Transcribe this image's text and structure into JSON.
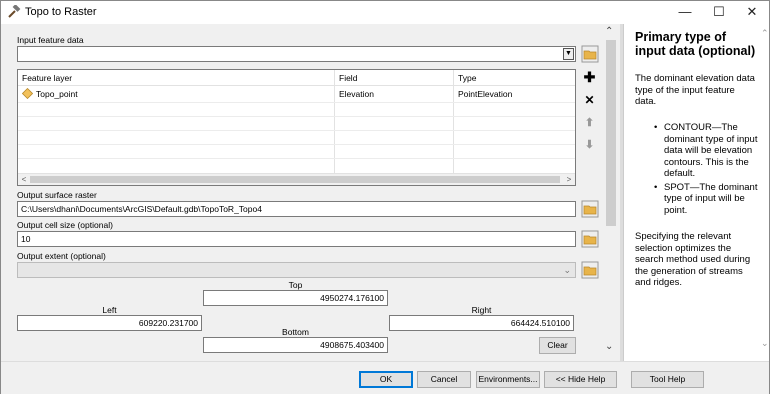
{
  "window": {
    "title": "Topo to Raster",
    "minimize": "—",
    "maximize": "☐",
    "close": "✕"
  },
  "params": {
    "input_feature_data_label": "Input feature data",
    "input_feature_data_value": "",
    "table": {
      "columns": [
        "Feature layer",
        "Field",
        "Type"
      ],
      "rows": [
        {
          "layer": "Topo_point",
          "field": "Elevation",
          "type": "PointElevation"
        }
      ]
    },
    "output_surface_raster_label": "Output surface raster",
    "output_surface_raster_value": "C:\\Users\\dhani\\Documents\\ArcGIS\\Default.gdb\\TopoToR_Topo4",
    "output_cell_size_label": "Output cell size (optional)",
    "output_cell_size_value": "10",
    "output_extent_label": "Output extent (optional)",
    "output_extent_value": "",
    "extent": {
      "top_label": "Top",
      "top_value": "4950274.176100",
      "left_label": "Left",
      "left_value": "609220.231700",
      "right_label": "Right",
      "right_value": "664424.510100",
      "bottom_label": "Bottom",
      "bottom_value": "4908675.403400",
      "clear_label": "Clear"
    }
  },
  "help": {
    "title": "Primary type of input data (optional)",
    "intro": "The dominant elevation data type of the input feature data.",
    "items": [
      "CONTOUR—The dominant type of input data will be elevation contours. This is the default.",
      "SPOT—The dominant type of input will be point."
    ],
    "outro": "Specifying the relevant selection optimizes the search method used during the generation of streams and ridges."
  },
  "buttons": {
    "ok": "OK",
    "cancel": "Cancel",
    "environments": "Environments...",
    "hide_help": "<< Hide Help",
    "tool_help": "Tool Help"
  },
  "colors": {
    "accent": "#0078d7",
    "folder": "#e8b44a",
    "diamond": "#f2c15b"
  }
}
